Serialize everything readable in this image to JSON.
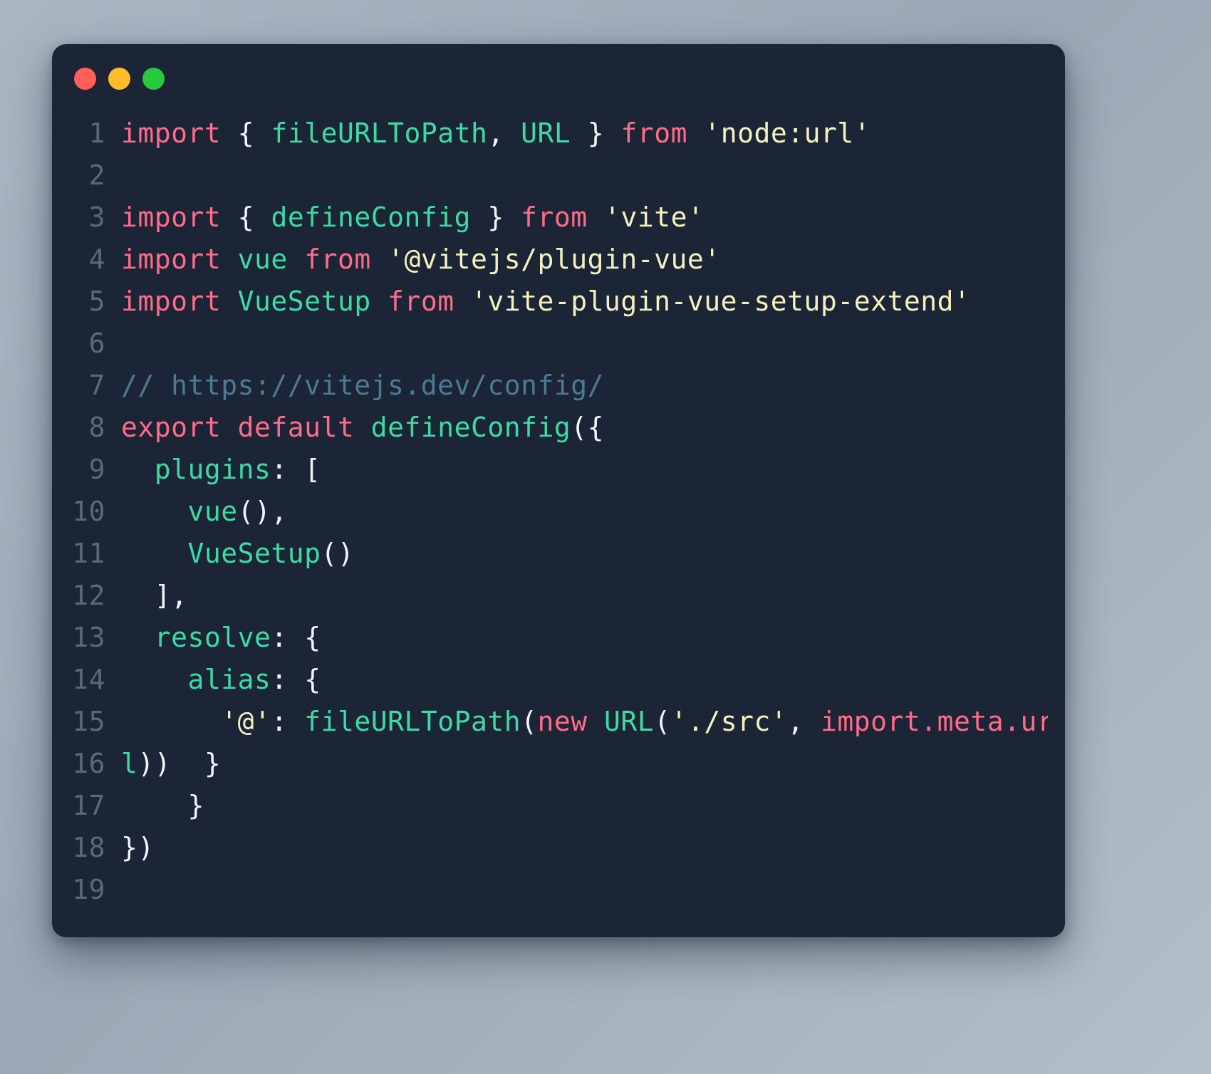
{
  "window": {
    "traffic_lights": [
      {
        "name": "close",
        "color": "#ff5f56"
      },
      {
        "name": "minimize",
        "color": "#ffbd2e"
      },
      {
        "name": "maximize",
        "color": "#27c93f"
      }
    ],
    "background_color": "#1b2535",
    "page_background_color": "#a9b6c2"
  },
  "editor": {
    "language": "javascript",
    "filename_hint": "vite.config.js",
    "line_numbers": [
      "1",
      "2",
      "3",
      "4",
      "5",
      "6",
      "7",
      "8",
      "9",
      "10",
      "11",
      "12",
      "13",
      "14",
      "15",
      "16",
      "17",
      "18",
      "19"
    ],
    "plain_text": [
      "import { fileURLToPath, URL } from 'node:url'",
      "",
      "import { defineConfig } from 'vite'",
      "import vue from '@vitejs/plugin-vue'",
      "import VueSetup from 'vite-plugin-vue-setup-extend'",
      "",
      "// https://vitejs.dev/config/",
      "export default defineConfig({",
      "  plugins: [",
      "    vue(),",
      "    VueSetup()",
      "  ],",
      "  resolve: {",
      "    alias: {",
      "      '@': fileURLToPath(new URL('./src', import.meta.ur",
      "l))  }",
      "    }",
      "})",
      ""
    ],
    "lines": [
      {
        "num": "1",
        "tokens": [
          {
            "t": "import",
            "c": "kw"
          },
          {
            "t": " ",
            "c": "plain"
          },
          {
            "t": "{",
            "c": "punc"
          },
          {
            "t": " ",
            "c": "plain"
          },
          {
            "t": "fileURLToPath",
            "c": "var"
          },
          {
            "t": ",",
            "c": "punc"
          },
          {
            "t": " ",
            "c": "plain"
          },
          {
            "t": "URL",
            "c": "var"
          },
          {
            "t": " ",
            "c": "plain"
          },
          {
            "t": "}",
            "c": "punc"
          },
          {
            "t": " ",
            "c": "plain"
          },
          {
            "t": "from",
            "c": "kw"
          },
          {
            "t": " ",
            "c": "plain"
          },
          {
            "t": "'node:url'",
            "c": "str"
          }
        ]
      },
      {
        "num": "2",
        "tokens": []
      },
      {
        "num": "3",
        "tokens": [
          {
            "t": "import",
            "c": "kw"
          },
          {
            "t": " ",
            "c": "plain"
          },
          {
            "t": "{",
            "c": "punc"
          },
          {
            "t": " ",
            "c": "plain"
          },
          {
            "t": "defineConfig",
            "c": "var"
          },
          {
            "t": " ",
            "c": "plain"
          },
          {
            "t": "}",
            "c": "punc"
          },
          {
            "t": " ",
            "c": "plain"
          },
          {
            "t": "from",
            "c": "kw"
          },
          {
            "t": " ",
            "c": "plain"
          },
          {
            "t": "'vite'",
            "c": "str"
          }
        ]
      },
      {
        "num": "4",
        "tokens": [
          {
            "t": "import",
            "c": "kw"
          },
          {
            "t": " ",
            "c": "plain"
          },
          {
            "t": "vue",
            "c": "var"
          },
          {
            "t": " ",
            "c": "plain"
          },
          {
            "t": "from",
            "c": "kw"
          },
          {
            "t": " ",
            "c": "plain"
          },
          {
            "t": "'@vitejs/plugin-vue'",
            "c": "str"
          }
        ]
      },
      {
        "num": "5",
        "tokens": [
          {
            "t": "import",
            "c": "kw"
          },
          {
            "t": " ",
            "c": "plain"
          },
          {
            "t": "VueSetup",
            "c": "var"
          },
          {
            "t": " ",
            "c": "plain"
          },
          {
            "t": "from",
            "c": "kw"
          },
          {
            "t": " ",
            "c": "plain"
          },
          {
            "t": "'vite-plugin-vue-setup-extend'",
            "c": "str"
          }
        ]
      },
      {
        "num": "6",
        "tokens": []
      },
      {
        "num": "7",
        "tokens": [
          {
            "t": "// https://vitejs.dev/config/",
            "c": "comment"
          }
        ]
      },
      {
        "num": "8",
        "tokens": [
          {
            "t": "export",
            "c": "kw"
          },
          {
            "t": " ",
            "c": "plain"
          },
          {
            "t": "default",
            "c": "kw"
          },
          {
            "t": " ",
            "c": "plain"
          },
          {
            "t": "defineConfig",
            "c": "fn"
          },
          {
            "t": "({",
            "c": "punc"
          }
        ]
      },
      {
        "num": "9",
        "tokens": [
          {
            "t": "  ",
            "c": "plain"
          },
          {
            "t": "plugins",
            "c": "prop"
          },
          {
            "t": ":",
            "c": "punc"
          },
          {
            "t": " ",
            "c": "plain"
          },
          {
            "t": "[",
            "c": "punc"
          }
        ]
      },
      {
        "num": "10",
        "tokens": [
          {
            "t": "    ",
            "c": "plain"
          },
          {
            "t": "vue",
            "c": "fn"
          },
          {
            "t": "(),",
            "c": "punc"
          }
        ]
      },
      {
        "num": "11",
        "tokens": [
          {
            "t": "    ",
            "c": "plain"
          },
          {
            "t": "VueSetup",
            "c": "fn"
          },
          {
            "t": "()",
            "c": "punc"
          }
        ]
      },
      {
        "num": "12",
        "tokens": [
          {
            "t": "  ",
            "c": "plain"
          },
          {
            "t": "],",
            "c": "punc"
          }
        ]
      },
      {
        "num": "13",
        "tokens": [
          {
            "t": "  ",
            "c": "plain"
          },
          {
            "t": "resolve",
            "c": "prop"
          },
          {
            "t": ":",
            "c": "punc"
          },
          {
            "t": " ",
            "c": "plain"
          },
          {
            "t": "{",
            "c": "punc"
          }
        ]
      },
      {
        "num": "14",
        "tokens": [
          {
            "t": "    ",
            "c": "plain"
          },
          {
            "t": "alias",
            "c": "prop"
          },
          {
            "t": ":",
            "c": "punc"
          },
          {
            "t": " ",
            "c": "plain"
          },
          {
            "t": "{",
            "c": "punc"
          }
        ]
      },
      {
        "num": "15",
        "tokens": [
          {
            "t": "      ",
            "c": "plain"
          },
          {
            "t": "'@'",
            "c": "str"
          },
          {
            "t": ":",
            "c": "punc"
          },
          {
            "t": " ",
            "c": "plain"
          },
          {
            "t": "fileURLToPath",
            "c": "fn"
          },
          {
            "t": "(",
            "c": "punc"
          },
          {
            "t": "new",
            "c": "kw"
          },
          {
            "t": " ",
            "c": "plain"
          },
          {
            "t": "URL",
            "c": "fn"
          },
          {
            "t": "(",
            "c": "punc"
          },
          {
            "t": "'./src'",
            "c": "str"
          },
          {
            "t": ",",
            "c": "punc"
          },
          {
            "t": " ",
            "c": "plain"
          },
          {
            "t": "import.meta.ur",
            "c": "kw"
          }
        ]
      },
      {
        "num": "16",
        "tokens": [
          {
            "t": "l",
            "c": "var"
          },
          {
            "t": "))",
            "c": "punc"
          },
          {
            "t": "  ",
            "c": "plain"
          },
          {
            "t": "}",
            "c": "punc"
          }
        ]
      },
      {
        "num": "17",
        "tokens": [
          {
            "t": "    ",
            "c": "plain"
          },
          {
            "t": "}",
            "c": "punc"
          }
        ]
      },
      {
        "num": "18",
        "tokens": [
          {
            "t": "})",
            "c": "punc"
          }
        ]
      },
      {
        "num": "19",
        "tokens": []
      }
    ]
  },
  "palette": {
    "keyword": "#ff6b8a",
    "function": "#3ddba4",
    "variable": "#3ddba4",
    "string": "#f5f0c0",
    "punctuation": "#f2f5f7",
    "comment": "#4d7a93",
    "line_number": "#5b6878"
  }
}
